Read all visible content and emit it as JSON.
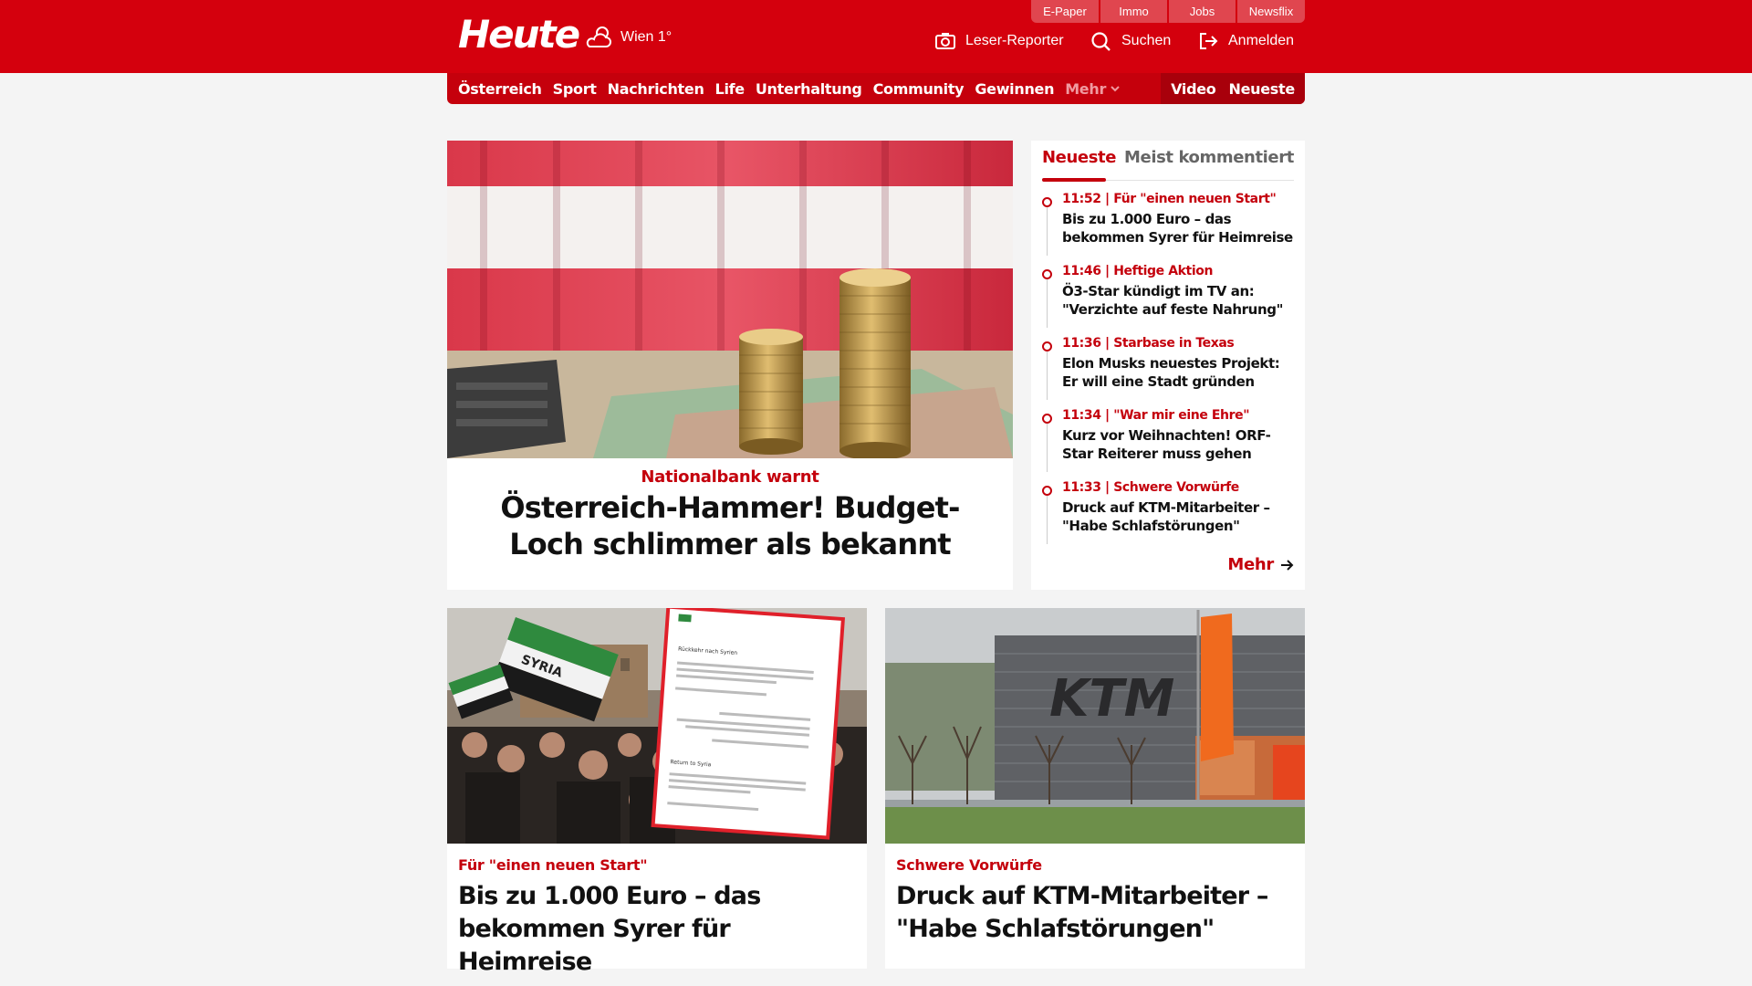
{
  "header": {
    "logo": "Heute",
    "weather": "Wien 1°",
    "service_links": [
      "E-Paper",
      "Immo",
      "Jobs",
      "Newsflix"
    ],
    "reporter": "Leser-Reporter",
    "search": "Suchen",
    "login": "Anmelden"
  },
  "nav": {
    "items": [
      "Österreich",
      "Sport",
      "Nachrichten",
      "Life",
      "Unterhaltung",
      "Community",
      "Gewinnen"
    ],
    "more": "Mehr",
    "video": "Video",
    "latest": "Neueste"
  },
  "hero": {
    "kicker": "Nationalbank warnt",
    "title": "Österreich-Hammer! Budget-Loch schlimmer als bekannt"
  },
  "sidebar": {
    "tab_active": "Neueste",
    "tab_inactive": "Meist kommentiert",
    "items": [
      {
        "meta": "11:52 | Für \"einen neuen Start\"",
        "title": "Bis zu 1.000 Euro – das bekommen Syrer für Heimreise"
      },
      {
        "meta": "11:46 | Heftige Aktion",
        "title": "Ö3-Star kündigt im TV an: \"Verzichte auf feste Nahrung\""
      },
      {
        "meta": "11:36 | Starbase in Texas",
        "title": "Elon Musks neuestes Projekt: Er will eine Stadt gründen"
      },
      {
        "meta": "11:34 | \"War mir eine Ehre\"",
        "title": "Kurz vor Weihnachten! ORF-Star Reiterer muss gehen"
      },
      {
        "meta": "11:33 | Schwere Vorwürfe",
        "title": "Druck auf KTM-Mitarbeiter – \"Habe Schlafstörungen\""
      }
    ],
    "more": "Mehr"
  },
  "cards": [
    {
      "kicker": "Für \"einen neuen Start\"",
      "title": "Bis zu 1.000 Euro – das bekommen Syrer für Heimreise"
    },
    {
      "kicker": "Schwere Vorwürfe",
      "title": "Druck auf KTM-Mitarbeiter – \"Habe Schlafstörungen\""
    }
  ],
  "images": {
    "syria_flag_text": "SYRIA",
    "ktm_logo": "KTM",
    "notice_heading": "Rückkehr nach Syrien",
    "notice_heading_en": "Return to Syria"
  },
  "colors": {
    "brand_red": "#d4000d",
    "nav_red": "#c5000c",
    "accent_red": "#c4000c"
  }
}
